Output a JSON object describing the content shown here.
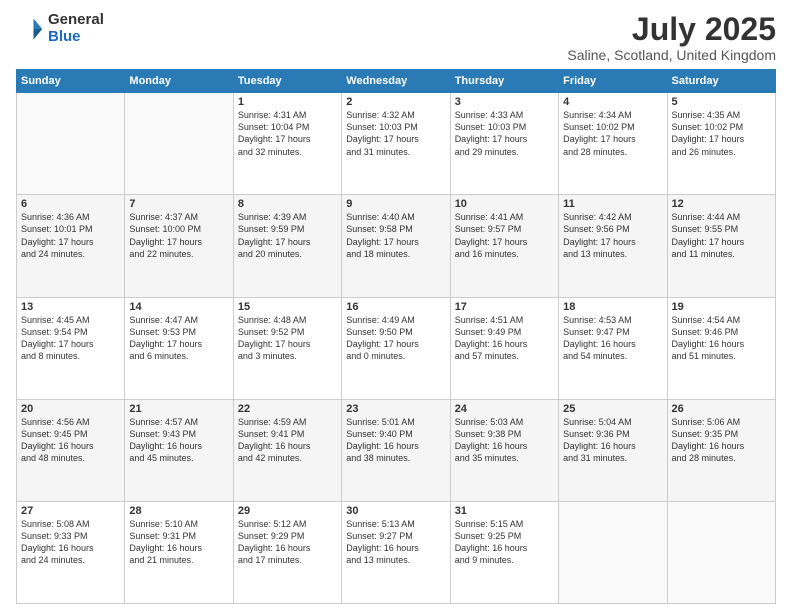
{
  "logo": {
    "general": "General",
    "blue": "Blue"
  },
  "title": "July 2025",
  "subtitle": "Saline, Scotland, United Kingdom",
  "days_header": [
    "Sunday",
    "Monday",
    "Tuesday",
    "Wednesday",
    "Thursday",
    "Friday",
    "Saturday"
  ],
  "weeks": [
    [
      {
        "day": "",
        "info": ""
      },
      {
        "day": "",
        "info": ""
      },
      {
        "day": "1",
        "info": "Sunrise: 4:31 AM\nSunset: 10:04 PM\nDaylight: 17 hours\nand 32 minutes."
      },
      {
        "day": "2",
        "info": "Sunrise: 4:32 AM\nSunset: 10:03 PM\nDaylight: 17 hours\nand 31 minutes."
      },
      {
        "day": "3",
        "info": "Sunrise: 4:33 AM\nSunset: 10:03 PM\nDaylight: 17 hours\nand 29 minutes."
      },
      {
        "day": "4",
        "info": "Sunrise: 4:34 AM\nSunset: 10:02 PM\nDaylight: 17 hours\nand 28 minutes."
      },
      {
        "day": "5",
        "info": "Sunrise: 4:35 AM\nSunset: 10:02 PM\nDaylight: 17 hours\nand 26 minutes."
      }
    ],
    [
      {
        "day": "6",
        "info": "Sunrise: 4:36 AM\nSunset: 10:01 PM\nDaylight: 17 hours\nand 24 minutes."
      },
      {
        "day": "7",
        "info": "Sunrise: 4:37 AM\nSunset: 10:00 PM\nDaylight: 17 hours\nand 22 minutes."
      },
      {
        "day": "8",
        "info": "Sunrise: 4:39 AM\nSunset: 9:59 PM\nDaylight: 17 hours\nand 20 minutes."
      },
      {
        "day": "9",
        "info": "Sunrise: 4:40 AM\nSunset: 9:58 PM\nDaylight: 17 hours\nand 18 minutes."
      },
      {
        "day": "10",
        "info": "Sunrise: 4:41 AM\nSunset: 9:57 PM\nDaylight: 17 hours\nand 16 minutes."
      },
      {
        "day": "11",
        "info": "Sunrise: 4:42 AM\nSunset: 9:56 PM\nDaylight: 17 hours\nand 13 minutes."
      },
      {
        "day": "12",
        "info": "Sunrise: 4:44 AM\nSunset: 9:55 PM\nDaylight: 17 hours\nand 11 minutes."
      }
    ],
    [
      {
        "day": "13",
        "info": "Sunrise: 4:45 AM\nSunset: 9:54 PM\nDaylight: 17 hours\nand 8 minutes."
      },
      {
        "day": "14",
        "info": "Sunrise: 4:47 AM\nSunset: 9:53 PM\nDaylight: 17 hours\nand 6 minutes."
      },
      {
        "day": "15",
        "info": "Sunrise: 4:48 AM\nSunset: 9:52 PM\nDaylight: 17 hours\nand 3 minutes."
      },
      {
        "day": "16",
        "info": "Sunrise: 4:49 AM\nSunset: 9:50 PM\nDaylight: 17 hours\nand 0 minutes."
      },
      {
        "day": "17",
        "info": "Sunrise: 4:51 AM\nSunset: 9:49 PM\nDaylight: 16 hours\nand 57 minutes."
      },
      {
        "day": "18",
        "info": "Sunrise: 4:53 AM\nSunset: 9:47 PM\nDaylight: 16 hours\nand 54 minutes."
      },
      {
        "day": "19",
        "info": "Sunrise: 4:54 AM\nSunset: 9:46 PM\nDaylight: 16 hours\nand 51 minutes."
      }
    ],
    [
      {
        "day": "20",
        "info": "Sunrise: 4:56 AM\nSunset: 9:45 PM\nDaylight: 16 hours\nand 48 minutes."
      },
      {
        "day": "21",
        "info": "Sunrise: 4:57 AM\nSunset: 9:43 PM\nDaylight: 16 hours\nand 45 minutes."
      },
      {
        "day": "22",
        "info": "Sunrise: 4:59 AM\nSunset: 9:41 PM\nDaylight: 16 hours\nand 42 minutes."
      },
      {
        "day": "23",
        "info": "Sunrise: 5:01 AM\nSunset: 9:40 PM\nDaylight: 16 hours\nand 38 minutes."
      },
      {
        "day": "24",
        "info": "Sunrise: 5:03 AM\nSunset: 9:38 PM\nDaylight: 16 hours\nand 35 minutes."
      },
      {
        "day": "25",
        "info": "Sunrise: 5:04 AM\nSunset: 9:36 PM\nDaylight: 16 hours\nand 31 minutes."
      },
      {
        "day": "26",
        "info": "Sunrise: 5:06 AM\nSunset: 9:35 PM\nDaylight: 16 hours\nand 28 minutes."
      }
    ],
    [
      {
        "day": "27",
        "info": "Sunrise: 5:08 AM\nSunset: 9:33 PM\nDaylight: 16 hours\nand 24 minutes."
      },
      {
        "day": "28",
        "info": "Sunrise: 5:10 AM\nSunset: 9:31 PM\nDaylight: 16 hours\nand 21 minutes."
      },
      {
        "day": "29",
        "info": "Sunrise: 5:12 AM\nSunset: 9:29 PM\nDaylight: 16 hours\nand 17 minutes."
      },
      {
        "day": "30",
        "info": "Sunrise: 5:13 AM\nSunset: 9:27 PM\nDaylight: 16 hours\nand 13 minutes."
      },
      {
        "day": "31",
        "info": "Sunrise: 5:15 AM\nSunset: 9:25 PM\nDaylight: 16 hours\nand 9 minutes."
      },
      {
        "day": "",
        "info": ""
      },
      {
        "day": "",
        "info": ""
      }
    ]
  ]
}
